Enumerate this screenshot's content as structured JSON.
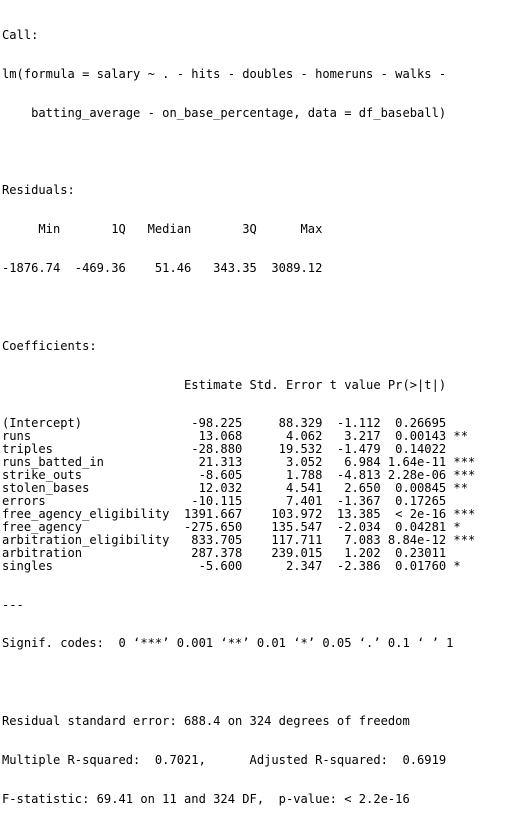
{
  "call": {
    "header": "Call:",
    "formula_line_1": "lm(formula = salary ~ . - hits - doubles - homeruns - walks -",
    "formula_line_2": "    batting_average - on_base_percentage, data = df_baseball)"
  },
  "residuals": {
    "header": "Residuals:",
    "labels_row": "     Min       1Q   Median       3Q      Max ",
    "values_row": "-1876.74  -469.36    51.46   343.35  3089.12 ",
    "labels": [
      "Min",
      "1Q",
      "Median",
      "3Q",
      "Max"
    ],
    "values": [
      "-1876.74",
      "-469.36",
      "51.46",
      "343.35",
      "3089.12"
    ]
  },
  "coefficients": {
    "header": "Coefficients:",
    "column_header_row": "                         Estimate Std. Error t value Pr(>|t|)    ",
    "columns": [
      "Estimate",
      "Std. Error",
      "t value",
      "Pr(>|t|)"
    ],
    "rows": [
      {
        "term": "(Intercept)",
        "estimate": "-98.225",
        "std_error": "88.329",
        "t_value": "-1.112",
        "p_value": "0.26695",
        "signif": "",
        "line": "(Intercept)               -98.225     88.329  -1.112  0.26695    "
      },
      {
        "term": "runs",
        "estimate": "13.068",
        "std_error": "4.062",
        "t_value": "3.217",
        "p_value": "0.00143",
        "signif": "**",
        "line": "runs                       13.068      4.062   3.217  0.00143 ** "
      },
      {
        "term": "triples",
        "estimate": "-28.880",
        "std_error": "19.532",
        "t_value": "-1.479",
        "p_value": "0.14022",
        "signif": "",
        "line": "triples                   -28.880     19.532  -1.479  0.14022    "
      },
      {
        "term": "runs_batted_in",
        "estimate": "21.313",
        "std_error": "3.052",
        "t_value": "6.984",
        "p_value": "1.64e-11",
        "signif": "***",
        "line": "runs_batted_in             21.313      3.052   6.984 1.64e-11 ***"
      },
      {
        "term": "strike_outs",
        "estimate": "-8.605",
        "std_error": "1.788",
        "t_value": "-4.813",
        "p_value": "2.28e-06",
        "signif": "***",
        "line": "strike_outs                -8.605      1.788  -4.813 2.28e-06 ***"
      },
      {
        "term": "stolen_bases",
        "estimate": "12.032",
        "std_error": "4.541",
        "t_value": "2.650",
        "p_value": "0.00845",
        "signif": "**",
        "line": "stolen_bases               12.032      4.541   2.650  0.00845 ** "
      },
      {
        "term": "errors",
        "estimate": "-10.115",
        "std_error": "7.401",
        "t_value": "-1.367",
        "p_value": "0.17265",
        "signif": "",
        "line": "errors                    -10.115      7.401  -1.367  0.17265    "
      },
      {
        "term": "free_agency_eligibility",
        "estimate": "1391.667",
        "std_error": "103.972",
        "t_value": "13.385",
        "p_value": "< 2e-16",
        "signif": "***",
        "line": "free_agency_eligibility  1391.667    103.972  13.385  < 2e-16 ***"
      },
      {
        "term": "free_agency",
        "estimate": "-275.650",
        "std_error": "135.547",
        "t_value": "-2.034",
        "p_value": "0.04281",
        "signif": "*",
        "line": "free_agency              -275.650    135.547  -2.034  0.04281 *  "
      },
      {
        "term": "arbitration_eligibility",
        "estimate": "833.705",
        "std_error": "117.711",
        "t_value": "7.083",
        "p_value": "8.84e-12",
        "signif": "***",
        "line": "arbitration_eligibility   833.705    117.711   7.083 8.84e-12 ***"
      },
      {
        "term": "arbitration",
        "estimate": "287.378",
        "std_error": "239.015",
        "t_value": "1.202",
        "p_value": "0.23011",
        "signif": "",
        "line": "arbitration               287.378    239.015   1.202  0.23011    "
      },
      {
        "term": "singles",
        "estimate": "-5.600",
        "std_error": "2.347",
        "t_value": "-2.386",
        "p_value": "0.01760",
        "signif": "*",
        "line": "singles                    -5.600      2.347  -2.386  0.01760 *  "
      }
    ],
    "divider": "---",
    "signif_codes": "Signif. codes:  0 ‘***’ 0.001 ‘**’ 0.01 ‘*’ 0.05 ‘.’ 0.1 ‘ ’ 1"
  },
  "summary": {
    "residual_standard_error": "Residual standard error: 688.4 on 324 degrees of freedom",
    "r_squared": "Multiple R-squared:  0.7021,\tAdjusted R-squared:  0.6919 ",
    "f_statistic": "F-statistic: 69.41 on 11 and 324 DF,  p-value: < 2.2e-16"
  }
}
